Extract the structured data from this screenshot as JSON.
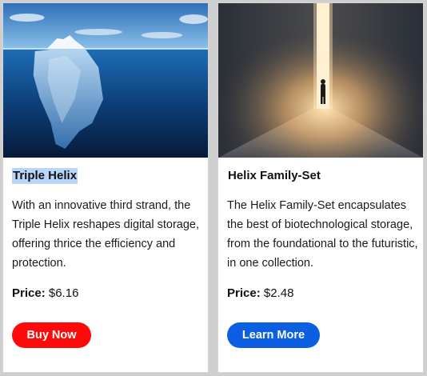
{
  "products": [
    {
      "title": "Triple Helix",
      "description": "With an innovative third strand, the Triple Helix reshapes digital storage, offering thrice the efficiency and protection.",
      "price_label": "Price:",
      "price_value": "$6.16",
      "button_label": "Buy Now",
      "button_color": "#ff0a0a",
      "image": "iceberg-image"
    },
    {
      "title": "Helix Family-Set",
      "description": "The Helix Family-Set encapsulates the best of biotechnological storage, from the foundational to the futuristic, in one collection.",
      "price_label": "Price:",
      "price_value": "$2.48",
      "button_label": "Learn More",
      "button_color": "#0c5fe3",
      "image": "light-doorway-image"
    }
  ],
  "selection_color": "#b9d6f8"
}
